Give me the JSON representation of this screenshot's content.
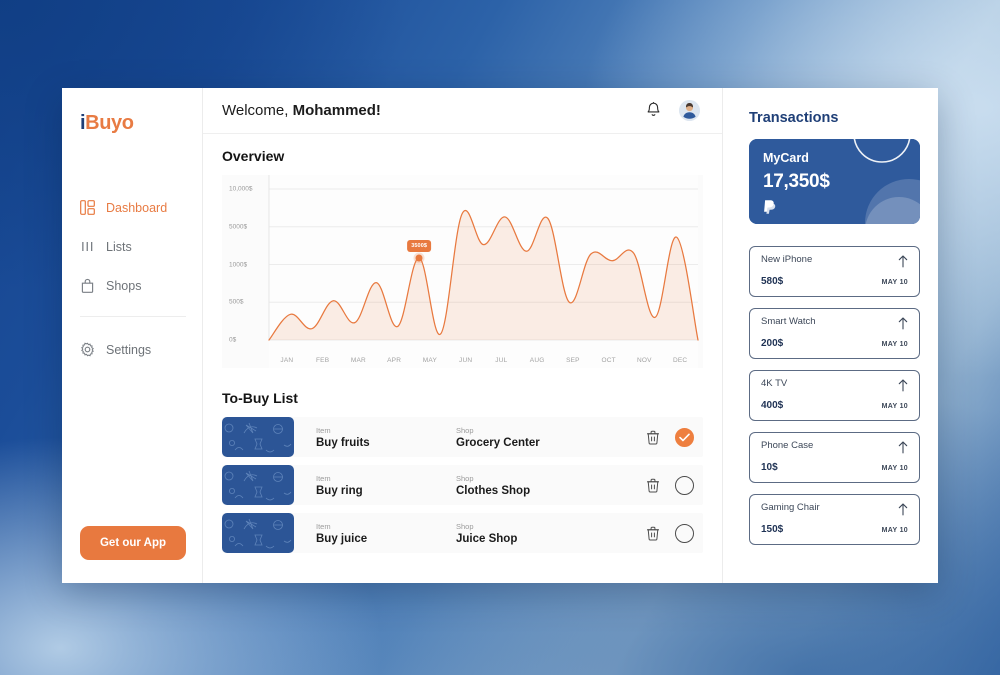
{
  "brand": {
    "logo_i": "i",
    "logo_rest": "Buyo",
    "accent": "#e8793f",
    "navy": "#1f3f77"
  },
  "sidebar": {
    "items": [
      {
        "label": "Dashboard",
        "icon": "dashboard-icon",
        "active": true
      },
      {
        "label": "Lists",
        "icon": "list-icon",
        "active": false
      },
      {
        "label": "Shops",
        "icon": "shopping-bag-icon",
        "active": false
      },
      {
        "label": "Settings",
        "icon": "gear-icon",
        "active": false
      }
    ],
    "cta_label": "Get our App"
  },
  "header": {
    "greeting_prefix": "Welcome, ",
    "greeting_name": "Mohammed!",
    "bell_icon": "notification-bell-icon",
    "avatar_icon": "user-avatar"
  },
  "main": {
    "overview_title": "Overview",
    "tobuy_title": "To-Buy List",
    "column_labels": {
      "item": "Item",
      "shop": "Shop"
    },
    "rows": [
      {
        "item": "Buy fruits",
        "shop": "Grocery Center",
        "done": true
      },
      {
        "item": "Buy ring",
        "shop": "Clothes Shop",
        "done": false
      },
      {
        "item": "Buy juice",
        "shop": "Juice Shop",
        "done": false
      }
    ]
  },
  "chart_data": {
    "type": "area",
    "title": "Overview",
    "xlabel": "",
    "ylabel": "",
    "grid": true,
    "legend": "none",
    "line_color": "#e8793f",
    "fill_color": "rgba(232,121,63,0.13)",
    "categories": [
      "JAN",
      "FEB",
      "MAR",
      "APR",
      "MAY",
      "JUN",
      "JUL",
      "AUG",
      "SEP",
      "OCT",
      "NOV",
      "DEC"
    ],
    "ytick_labels": [
      "10,000$",
      "5000$",
      "1000$",
      "500$",
      "0$"
    ],
    "ytick_values": [
      10000,
      5000,
      1000,
      500,
      0
    ],
    "annotation": {
      "label": "3500$",
      "category": "APR",
      "value": 1700
    },
    "values": [
      0,
      340,
      150,
      520,
      230,
      760,
      180,
      1700,
      80,
      6700,
      3100,
      6300,
      2400,
      6100,
      500,
      500,
      2100,
      1400,
      2200,
      300,
      3900,
      0
    ],
    "series": [
      {
        "name": "Spending",
        "points": [
          {
            "x": "JAN",
            "y": 0
          },
          {
            "x": "JAN",
            "y": 340
          },
          {
            "x": "FEB",
            "y": 150
          },
          {
            "x": "FEB",
            "y": 520
          },
          {
            "x": "MAR",
            "y": 230
          },
          {
            "x": "MAR",
            "y": 760
          },
          {
            "x": "APR",
            "y": 180
          },
          {
            "x": "APR",
            "y": 1700
          },
          {
            "x": "MAY",
            "y": 80
          },
          {
            "x": "JUN",
            "y": 6700
          },
          {
            "x": "JUL",
            "y": 3100
          },
          {
            "x": "JUL",
            "y": 6300
          },
          {
            "x": "AUG",
            "y": 2400
          },
          {
            "x": "AUG",
            "y": 6100
          },
          {
            "x": "SEP",
            "y": 500
          },
          {
            "x": "OCT",
            "y": 2100
          },
          {
            "x": "OCT",
            "y": 1400
          },
          {
            "x": "NOV",
            "y": 2200
          },
          {
            "x": "NOV",
            "y": 300
          },
          {
            "x": "DEC",
            "y": 3900
          },
          {
            "x": "DEC",
            "y": 0
          }
        ]
      }
    ]
  },
  "transactions": {
    "title": "Transactions",
    "card": {
      "name": "MyCard",
      "amount": "17,350$",
      "brand_icon": "paypal-icon"
    },
    "items": [
      {
        "name": "New iPhone",
        "amount": "580$",
        "date": "MAY 10",
        "arrow": "arrow-up-icon"
      },
      {
        "name": "Smart Watch",
        "amount": "200$",
        "date": "MAY 10",
        "arrow": "arrow-up-icon"
      },
      {
        "name": "4K TV",
        "amount": "400$",
        "date": "MAY 10",
        "arrow": "arrow-up-icon"
      },
      {
        "name": "Phone Case",
        "amount": "10$",
        "date": "MAY 10",
        "arrow": "arrow-up-icon"
      },
      {
        "name": "Gaming Chair",
        "amount": "150$",
        "date": "MAY 10",
        "arrow": "arrow-up-icon"
      }
    ]
  }
}
